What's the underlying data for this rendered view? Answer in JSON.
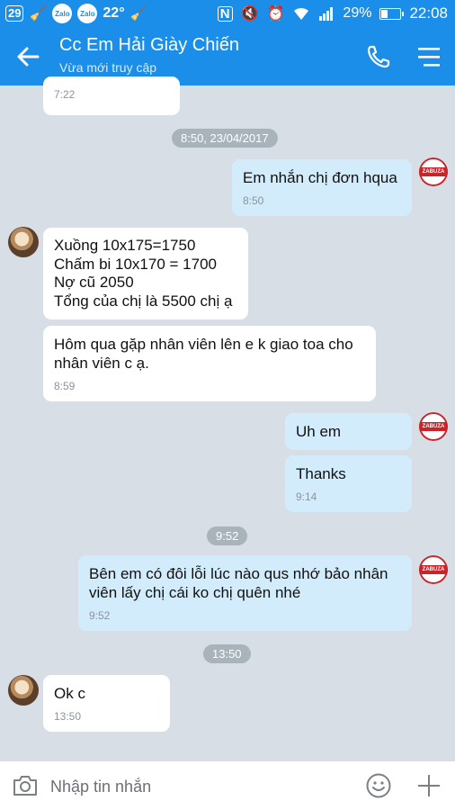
{
  "status_bar": {
    "badge": "29",
    "zalo1": "Zalo",
    "zalo2": "Zalo",
    "temperature": "22°",
    "battery_percent": "29%",
    "battery_level": 0.29,
    "time": "22:08"
  },
  "header": {
    "title": "Cc Em Hải Giày Chiến",
    "subtitle": "Vừa mới truy cập"
  },
  "avatar": {
    "self_label": "ZABUZA"
  },
  "messages": {
    "m0_time": "7:22",
    "date_pill": "8:50, 23/04/2017",
    "m1_text": "Em nhắn chị đơn hqua",
    "m1_time": "8:50",
    "m2_lines": [
      "Xuồng 10x175=1750",
      "Chấm bi 10x170 = 1700",
      "Nợ cũ 2050",
      "Tổng của chị là 5500 chị ạ"
    ],
    "m3_text": "Hôm qua gặp nhân viên lên e k giao toa cho nhân viên c ạ.",
    "m3_time": "8:59",
    "m4_text": "Uh em",
    "m5_text": "Thanks",
    "m5_time": "9:14",
    "pill_952": "9:52",
    "m6_text": "Bên em có đôi lỗi lúc nào qus nhớ bảo nhân viên lấy chị cái ko chị quên nhé",
    "m6_time": "9:52",
    "pill_1350": "13:50",
    "m7_text": "Ok c",
    "m7_time": "13:50"
  },
  "input": {
    "placeholder": "Nhập tin nhắn"
  },
  "colors": {
    "brand": "#1a8ee8",
    "bubble_out": "#d3ecfb",
    "bubble_in": "#ffffff",
    "chat_bg": "#d7dee5"
  }
}
